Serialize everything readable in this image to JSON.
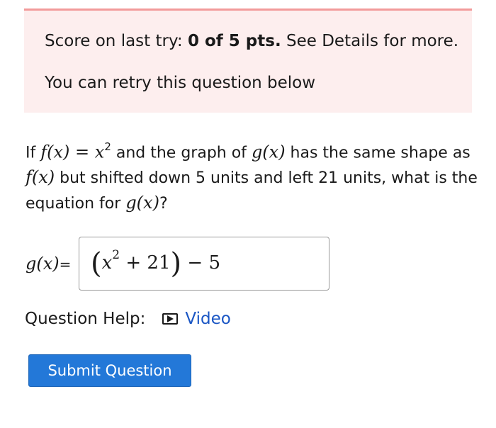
{
  "score": {
    "prefix": "Score on last try: ",
    "points": "0 of 5 pts.",
    "suffix": " See Details for more.",
    "retry": "You can retry this question below"
  },
  "question": {
    "t1": "If ",
    "f_x": "f(x)",
    "eq": " = ",
    "x": "x",
    "exp": "2",
    "t2": " and the graph of ",
    "g_x": "g(x)",
    "t3": " has the same shape as ",
    "f_x2": "f(x)",
    "t4": " but shifted down 5 units and left 21 units, what is the equation for ",
    "g_x2": "g(x)",
    "t5": "?"
  },
  "answer": {
    "label": "g(x)",
    "label_eq": "=",
    "open_paren": "(",
    "x": "x",
    "exp": "2",
    "plus": " + 21",
    "close_paren": ")",
    "minus": " − 5"
  },
  "help": {
    "label": "Question Help:",
    "video_icon": "play-icon",
    "video_label": "Video"
  },
  "submit": {
    "label": "Submit Question"
  },
  "colors": {
    "alert_bg": "#fdeeee",
    "alert_border": "#f29a9a",
    "link": "#1a56c4",
    "button": "#2378d8"
  }
}
